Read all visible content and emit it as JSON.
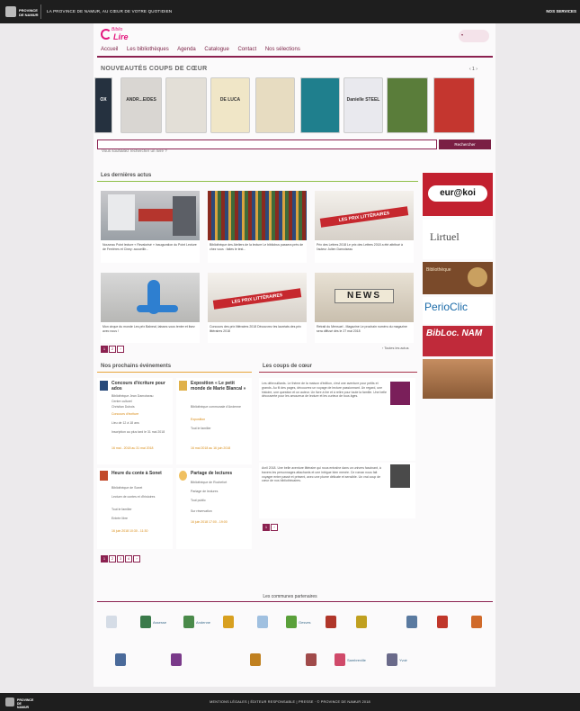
{
  "topbar": {
    "logo_text": "PROVINCE DE NAMUR",
    "tagline": "LA PROVINCE DE NAMUR, AU CŒUR DE VOTRE QUOTIDIEN",
    "right_link": "NOS SERVICES"
  },
  "brand": {
    "line1": "Biblio",
    "line2": "Lire"
  },
  "nav": [
    "Accueil",
    "Les bibliothèques",
    "Agenda",
    "Catalogue",
    "Contact",
    "Nos sélections"
  ],
  "carousel": {
    "title": "NOUVEAUTÉS COUPS DE CŒUR",
    "pager": "‹  1  ›",
    "books": [
      {
        "text": "OX",
        "bg": "#25313f"
      },
      {
        "text": "ANDR...EIDES",
        "bg": "#d9d6d2"
      },
      {
        "text": "",
        "bg": "#e3dfd7"
      },
      {
        "text": "DE LUCA",
        "bg": "#f0e6c7"
      },
      {
        "text": "",
        "bg": "#e7dcc1"
      },
      {
        "text": "",
        "bg": "#1f7f8d"
      },
      {
        "text": "Danielle STEEL",
        "bg": "#e9e9ee"
      },
      {
        "text": "",
        "bg": "#5a7d3a"
      },
      {
        "text": "",
        "bg": "#c4362f"
      }
    ]
  },
  "search": {
    "placeholder": "Vous souhaitez rechercher un livre ?",
    "button": "Rechercher"
  },
  "news": {
    "title": "Les dernières actus",
    "items": [
      {
        "caption": "Nouveau Point lecture « Revalorisé » Inauguration du Point Lecture de Ferrières et Ciney: accueillir..."
      },
      {
        "caption": "Bibliothèque des Ateliers de la lecture Le bibliobus passera près de chez vous : faites le test..."
      },
      {
        "caption": "Prix des Lettres 2018 Le prix des Lettres 2018 a été attribué à l'auteur Julien Damoiseau"
      },
      {
        "caption": "Mon cirque du monde Les prix Balneal, laissez-vous tenter et lisez avec nous !"
      },
      {
        "caption": "Concours des prix littéraires 2018 Découvrez les lauréats des prix littéraires 2018"
      },
      {
        "caption": "Retrait du Mensuel - Magazine Le prochain numéro du magazine sera diffusé dès le 27 mai 2018"
      }
    ],
    "ribbon": "LES PRIX LITTÉRAIRES",
    "news_word": "NEWS",
    "all_link": "› Toutes les actus",
    "pager": [
      "1",
      "2",
      "›"
    ]
  },
  "ads": [
    "eur@koi",
    "Lirtuel",
    "Bibliothèque",
    "PerioClic",
    "BibLoc. NAM",
    ""
  ],
  "events": {
    "title": "Nos prochains événements",
    "items": [
      {
        "title": "Concours d'écriture pour ados",
        "lines": [
          "Bibliothèque Jean Damoiseau",
          "Centre culturel",
          "Christian Dubois",
          "Concours d'écriture",
          "Lieu de 12 à 18 ans",
          "Inscription au plus tard le 31 mai 2018"
        ],
        "date": "16 mai - 2018 au 31 mai 2018"
      },
      {
        "title": "Exposition « Le petit monde de Marie Blancal »",
        "lines": [
          "Bibliothèque communale d'Andenne",
          "Exposition",
          "Tout le familier"
        ],
        "date": "16 mai 2018 au 16 juin 2018"
      },
      {
        "title": "Heure du conte à Sonet",
        "lines": [
          "Bibliothèque de Sonet",
          "Lecture de contes et d'histoires",
          "Tout le familier",
          "Entrée libre"
        ],
        "date": "16 juin 2018 10:30 - 11:30"
      },
      {
        "title": "Partage de lectures",
        "lines": [
          "Bibliothèque de Rochefort",
          "Partage de lectures",
          "Tout public",
          "Sur réservation"
        ],
        "date": "16 juin 2018 17:00 - 19:00"
      }
    ],
    "pager": [
      "1",
      "2",
      "3",
      "4",
      "›"
    ]
  },
  "coups": {
    "title": "Les coups de cœur",
    "items": [
      {
        "text": "Les débrouillards. Le thème de la maison d'édition, c'est une aventure pour petits et grands. Au fil des pages, découvrez un voyage de lecture passionnant. Un regard, une histoire, une question et un auteur. Un livre à lire et à relire pour toute la famille. Une belle découverte pour les amoureux de lecture et les curieux de tous âges."
      },
      {
        "text": "Avril 2018. Une belle aventure littéraire qui nous entraîne dans un univers fascinant, à travers les personnages attachants et une intrigue bien menée. Ce roman nous fait voyager entre passé et présent, avec une plume délicate et sensible. Un vrai coup de cœur de nos bibliothécaires."
      }
    ],
    "pager": [
      "1",
      "›"
    ]
  },
  "communes": {
    "title": "Les communes partenaires",
    "logos": [
      "",
      "Assesse",
      "Andenne",
      "",
      "",
      "Gesves",
      "",
      "",
      "",
      "",
      "",
      "",
      "",
      "",
      "",
      "Sambreville",
      "Yvoir"
    ]
  },
  "footer": {
    "logo_text": "PROVINCE DE NAMUR",
    "links": "MENTIONS LÉGALES | ÉDITEUR RESPONSABLE | PRESSE · © PROVINCE DE NAMUR 2018"
  }
}
